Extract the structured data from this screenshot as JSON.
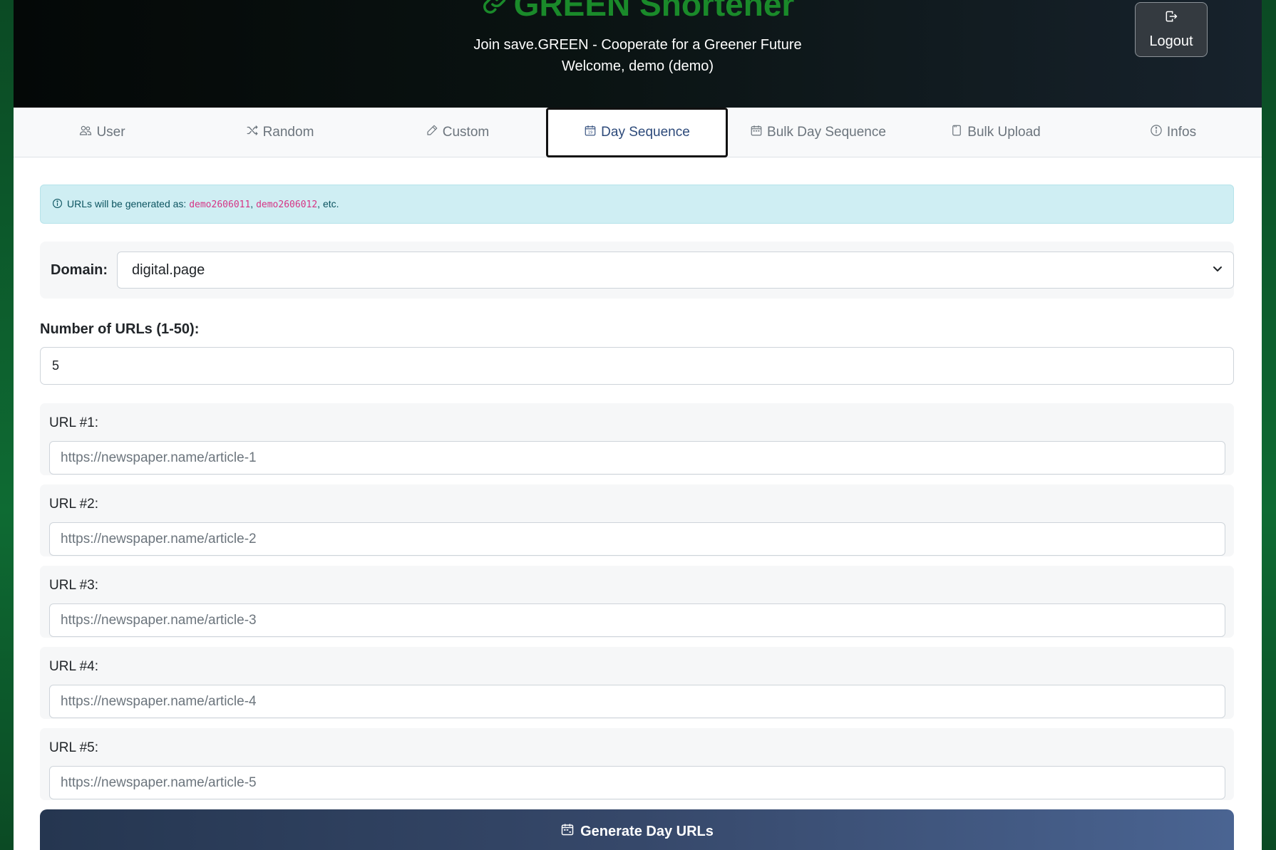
{
  "header": {
    "brand": "GREEN Shortener",
    "brand_icon": "link-icon",
    "subtitle": "Join save.GREEN - Cooperate for a Greener Future",
    "welcome": "Welcome, demo (demo)",
    "logout_label": "Logout",
    "colors": {
      "brand": "#1a8a2a"
    }
  },
  "tabs": [
    {
      "label": "User",
      "icon": "people-icon",
      "active": false
    },
    {
      "label": "Random",
      "icon": "shuffle-icon",
      "active": false
    },
    {
      "label": "Custom",
      "icon": "pencil-icon",
      "active": false
    },
    {
      "label": "Day Sequence",
      "icon": "calendar-date-icon",
      "active": true
    },
    {
      "label": "Bulk Day Sequence",
      "icon": "calendar-icon",
      "active": false
    },
    {
      "label": "Bulk Upload",
      "icon": "file-icon",
      "active": false
    },
    {
      "label": "Infos",
      "icon": "info-icon",
      "active": false
    }
  ],
  "alert": {
    "prefix": "URLs will be generated as: ",
    "example1": "demo2606011",
    "sep": ", ",
    "example2": "demo2606012",
    "suffix": ", etc."
  },
  "domain": {
    "label": "Domain:",
    "value": "digital.page"
  },
  "count": {
    "label": "Number of URLs (1-50):",
    "value": "5"
  },
  "urls": [
    {
      "label": "URL #1:",
      "placeholder": "https://newspaper.name/article-1"
    },
    {
      "label": "URL #2:",
      "placeholder": "https://newspaper.name/article-2"
    },
    {
      "label": "URL #3:",
      "placeholder": "https://newspaper.name/article-3"
    },
    {
      "label": "URL #4:",
      "placeholder": "https://newspaper.name/article-4"
    },
    {
      "label": "URL #5:",
      "placeholder": "https://newspaper.name/article-5"
    }
  ],
  "generate_label": "Generate Day URLs"
}
